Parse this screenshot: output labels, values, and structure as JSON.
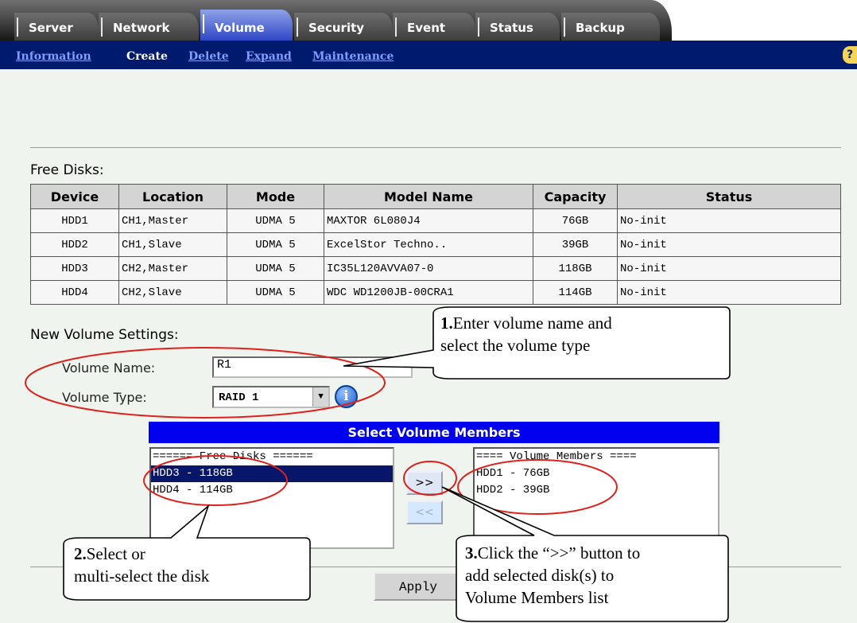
{
  "tabs": [
    {
      "label": "Server",
      "active": false
    },
    {
      "label": "Network",
      "active": false
    },
    {
      "label": "Volume",
      "active": true
    },
    {
      "label": "Security",
      "active": false
    },
    {
      "label": "Event",
      "active": false
    },
    {
      "label": "Status",
      "active": false
    },
    {
      "label": "Backup",
      "active": false
    }
  ],
  "subnav": {
    "items": [
      "Information",
      "Create",
      "Delete",
      "Expand",
      "Maintenance"
    ],
    "current": "Create",
    "help_icon": "question-icon"
  },
  "free_disks": {
    "title": "Free Disks:",
    "columns": [
      "Device",
      "Location",
      "Mode",
      "Model Name",
      "Capacity",
      "Status"
    ],
    "rows": [
      [
        "HDD1",
        "CH1,Master",
        "UDMA 5",
        "MAXTOR 6L080J4",
        "76GB",
        "No-init"
      ],
      [
        "HDD2",
        "CH1,Slave",
        "UDMA 5",
        "ExcelStor Techno..",
        "39GB",
        "No-init"
      ],
      [
        "HDD3",
        "CH2,Master",
        "UDMA 5",
        "IC35L120AVVA07-0",
        "118GB",
        "No-init"
      ],
      [
        "HDD4",
        "CH2,Slave",
        "UDMA 5",
        "WDC WD1200JB-00CRA1",
        "114GB",
        "No-init"
      ]
    ]
  },
  "settings": {
    "title": "New Volume Settings:",
    "volume_name_label": "Volume Name:",
    "volume_name_value": "R1",
    "volume_type_label": "Volume Type:",
    "volume_type_value": "RAID 1",
    "info_icon": "info-icon"
  },
  "members": {
    "title": "Select Volume Members",
    "free_header": "====== Free Disks ======",
    "free_items": [
      "HDD3 - 118GB",
      "HDD4 - 114GB"
    ],
    "free_selected": "HDD3 - 118GB",
    "member_header": "==== Volume Members ====",
    "member_items": [
      "HDD1 - 76GB",
      "HDD2 - 39GB"
    ],
    "add_label": ">>",
    "remove_label": "<<"
  },
  "apply_label": "Apply",
  "annotations": {
    "callout1_num": "1.",
    "callout1_line1": "Enter volume name and",
    "callout1_line2": "select the volume type",
    "callout2_num": "2.",
    "callout2_line1": "Select or",
    "callout2_line2": "multi-select the disk",
    "callout3_num": "3.",
    "callout3_line1": "Click the “>>” button to",
    "callout3_line2": "add selected disk(s) to",
    "callout3_line3": "Volume Members list",
    "highlight_color": "#e0201c"
  }
}
